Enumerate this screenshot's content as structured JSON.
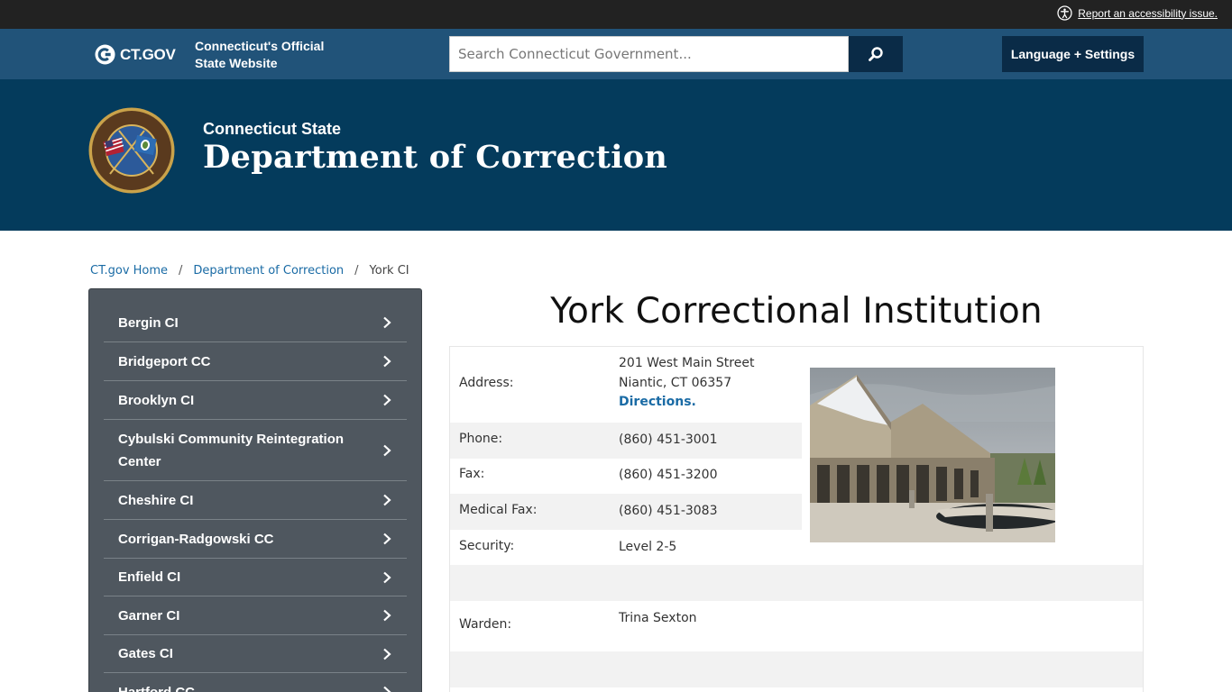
{
  "topbar": {
    "accessibility_link": "Report an accessibility issue."
  },
  "header": {
    "logo_text": "CT.GOV",
    "tagline_line1": "Connecticut's Official",
    "tagline_line2": "State Website",
    "search_placeholder": "Search Connecticut Government...",
    "language_button": "Language + Settings"
  },
  "banner": {
    "subtitle": "Connecticut State",
    "title": "Department of Correction"
  },
  "breadcrumb": {
    "home": "CT.gov Home",
    "dept": "Department of Correction",
    "current": "York CI",
    "separator": "/"
  },
  "sidebar": {
    "items": [
      "Bergin CI",
      "Bridgeport CC",
      "Brooklyn CI",
      "Cybulski Community Reintegration Center",
      "Cheshire CI",
      "Corrigan-Radgowski CC",
      "Enfield CI",
      "Garner CI",
      "Gates CI",
      "Hartford CC"
    ]
  },
  "main": {
    "title": "York Correctional Institution",
    "address_label": "Address:",
    "address_line1": "201 West Main Street",
    "address_line2": "Niantic, CT 06357",
    "directions": "Directions.",
    "phone_label": "Phone:",
    "phone": "(860) 451-3001",
    "fax_label": "Fax:",
    "fax": "(860) 451-3200",
    "medical_fax_label": "Medical Fax:",
    "medical_fax": "(860) 451-3083",
    "security_label": "Security:",
    "security": "Level 2-5",
    "warden_label": "Warden:",
    "warden": "Trina Sexton"
  },
  "icons": {
    "accessibility": "accessibility-icon",
    "logo": "ct-logo-icon",
    "search": "search-icon",
    "chevron": "chevron-right-icon"
  },
  "colors": {
    "topbar": "#222222",
    "header": "#215379",
    "banner": "#043b5c",
    "button": "#0a2b47",
    "sidebar": "#4f575f",
    "link": "#1a6ba5"
  }
}
